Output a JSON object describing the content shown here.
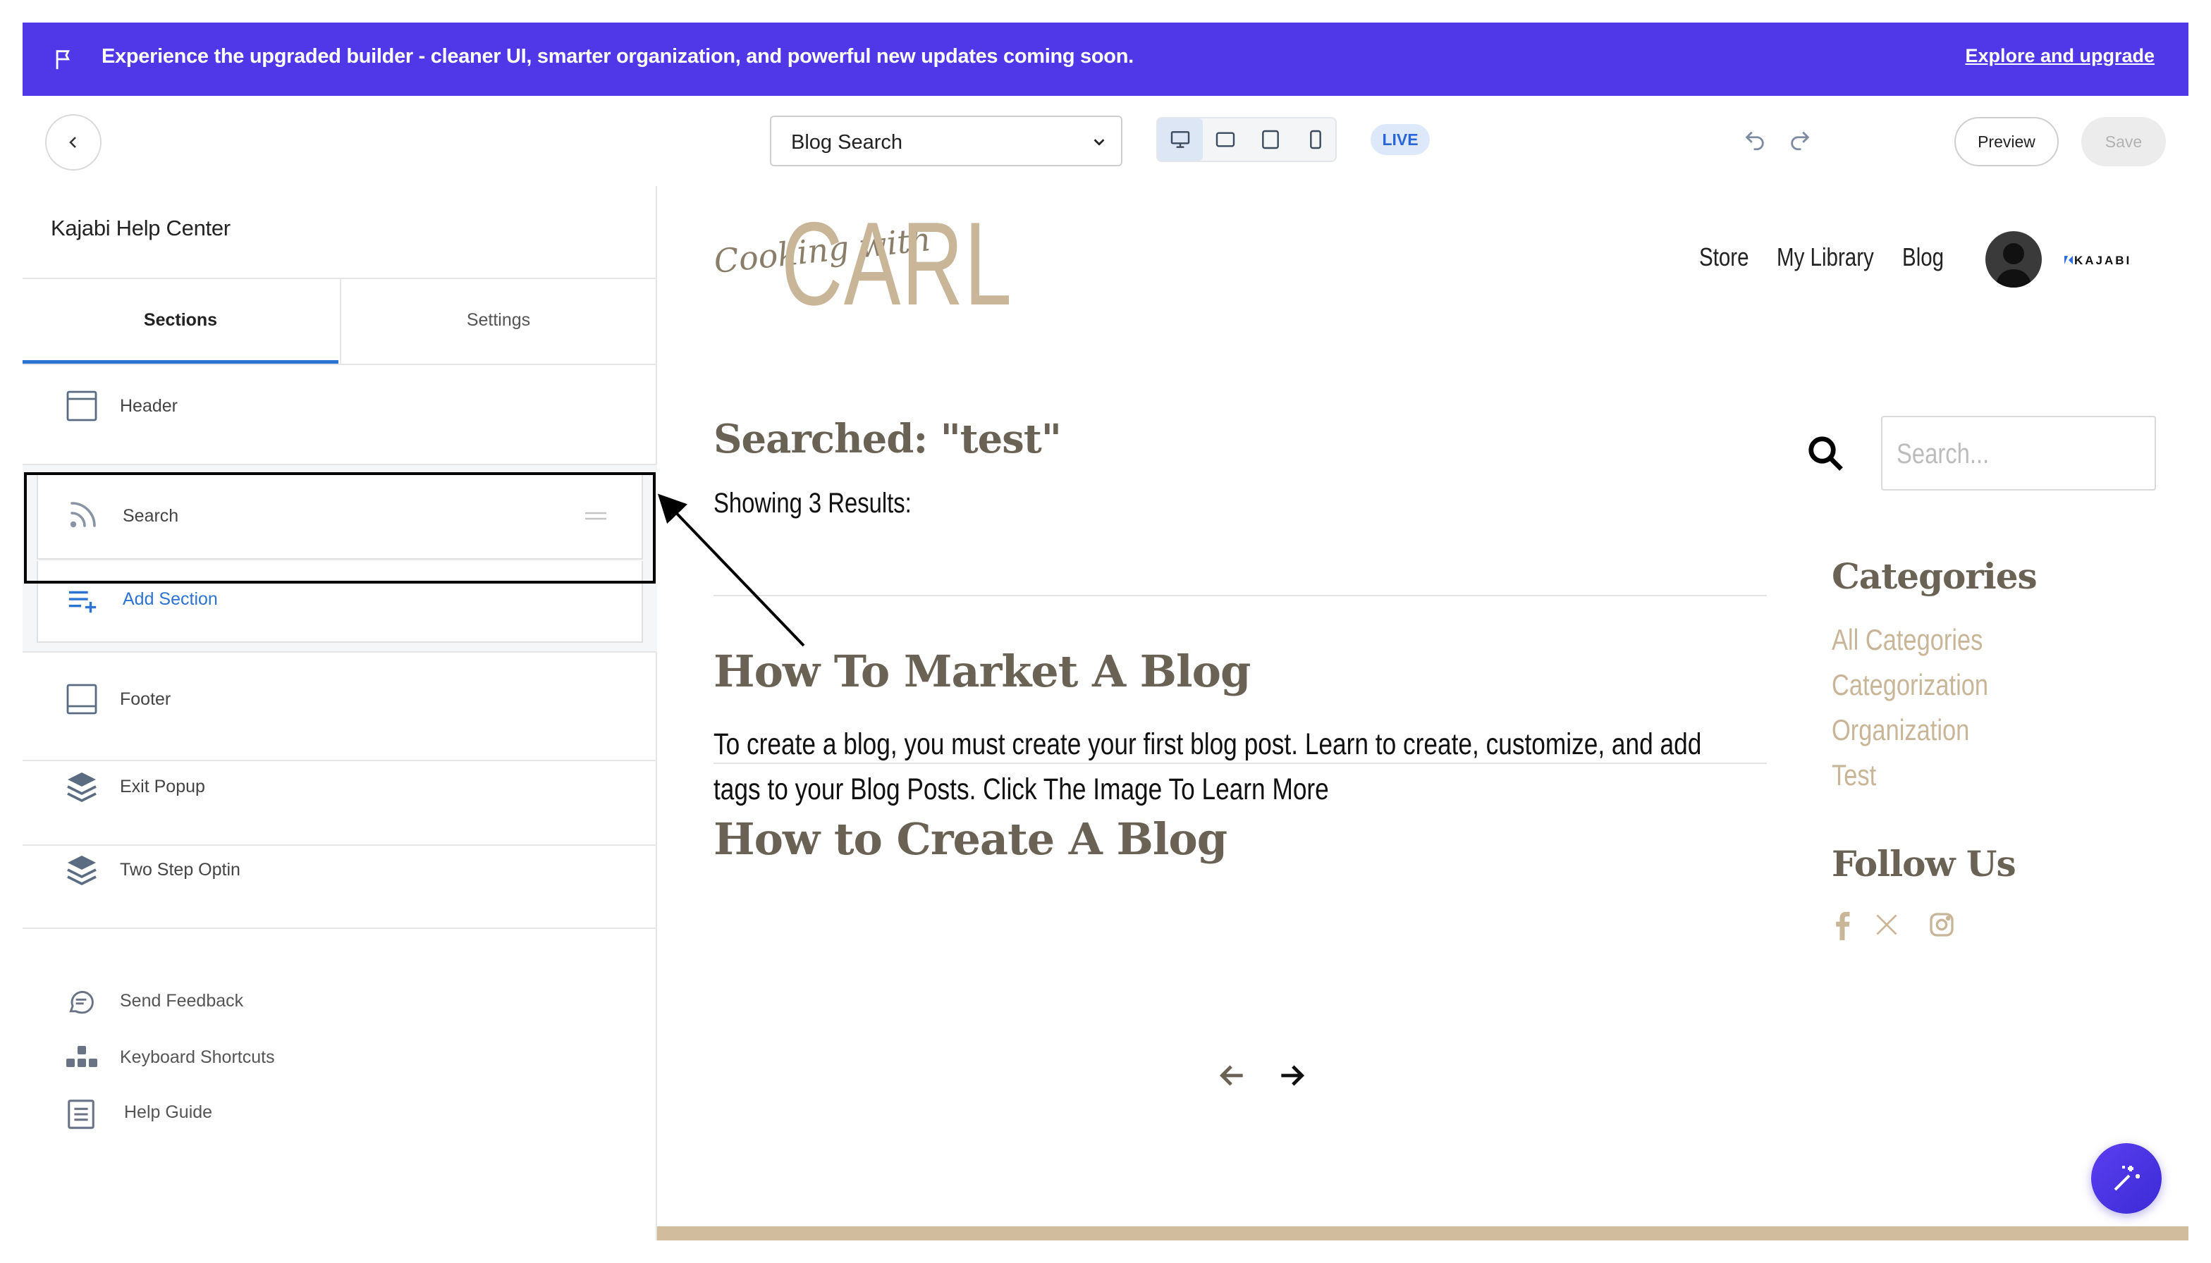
{
  "banner": {
    "message": "Experience the upgraded builder - cleaner UI, smarter organization, and powerful new updates coming soon.",
    "link": "Explore and upgrade"
  },
  "toolbar": {
    "page_select": "Blog Search",
    "devices": [
      "desktop-icon",
      "tablet-landscape-icon",
      "tablet-portrait-icon",
      "mobile-icon"
    ],
    "active_device": "desktop",
    "live_badge": "LIVE",
    "preview": "Preview",
    "save": "Save"
  },
  "sidebar": {
    "title": "Kajabi Help Center",
    "tabs": [
      "Sections",
      "Settings"
    ],
    "active_tab": "Sections",
    "sections": {
      "header": "Header",
      "search": "Search",
      "add": "Add Section",
      "footer": "Footer",
      "exit_popup": "Exit Popup",
      "two_step": "Two Step Optin"
    },
    "utilities": {
      "feedback": "Send Feedback",
      "shortcuts": "Keyboard Shortcuts",
      "guide": "Help Guide"
    }
  },
  "preview": {
    "logo_script": "Cooking with",
    "logo_big": "CARL",
    "nav": [
      "Store",
      "My Library",
      "Blog"
    ],
    "kajabi_badge": "KAJABI",
    "searched": "Searched: \"test\"",
    "showing": "Showing 3 Results:",
    "posts": [
      {
        "title": "How To Market A Blog",
        "excerpt": ""
      },
      {
        "title": "How to Create A Blog",
        "excerpt": "To create a blog, you must create your first blog post. Learn to create, customize, and add tags to your Blog Posts. Click The Image  To Learn More"
      }
    ],
    "search_placeholder": "Search...",
    "categories_heading": "Categories",
    "categories": [
      "All Categories",
      "Categorization",
      "Organization",
      "Test"
    ],
    "follow_heading": "Follow Us",
    "social": [
      "facebook-icon",
      "x-icon",
      "instagram-icon"
    ]
  },
  "colors": {
    "banner": "#5038e9",
    "accent_blue": "#2c73d2",
    "tan": "#c9b597",
    "heading_brown": "#6b6256"
  }
}
